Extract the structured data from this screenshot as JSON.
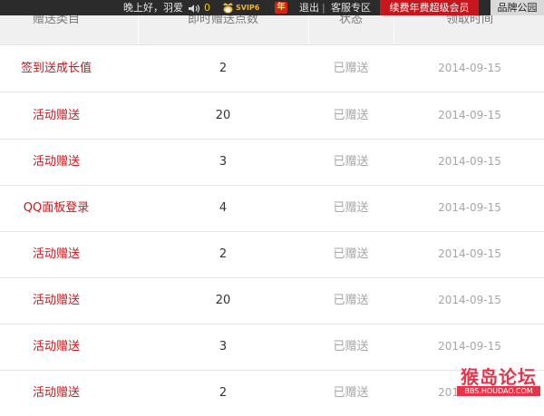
{
  "topbar": {
    "greeting": "晚上好，羽爱",
    "points": "0",
    "vip_label": "SVIP6",
    "nian_badge": "年",
    "logout": "退出",
    "separator": "|",
    "service": "客服专区",
    "renew": "续费年费超级会员",
    "brand": "品牌公园",
    "colors": {
      "bar": "#2b2b2b",
      "renew": "#c8161d",
      "points": "#f2c811"
    }
  },
  "table": {
    "headers": [
      "赠送类目",
      "即时赠送点数",
      "状态",
      "领取时间"
    ],
    "rows": [
      {
        "category": "签到送成长值",
        "points": "2",
        "status": "已赠送",
        "date": "2014-09-15"
      },
      {
        "category": "活动赠送",
        "points": "20",
        "status": "已赠送",
        "date": "2014-09-15"
      },
      {
        "category": "活动赠送",
        "points": "3",
        "status": "已赠送",
        "date": "2014-09-15"
      },
      {
        "category": "QQ面板登录",
        "points": "4",
        "status": "已赠送",
        "date": "2014-09-15"
      },
      {
        "category": "活动赠送",
        "points": "2",
        "status": "已赠送",
        "date": "2014-09-15"
      },
      {
        "category": "活动赠送",
        "points": "20",
        "status": "已赠送",
        "date": "2014-09-15"
      },
      {
        "category": "活动赠送",
        "points": "3",
        "status": "已赠送",
        "date": "2014-09-15"
      },
      {
        "category": "活动赠送",
        "points": "2",
        "status": "已赠送",
        "date": "2014-09-15"
      }
    ],
    "colors": {
      "category": "#c8161d",
      "points": "#333333",
      "status": "#a6a6a6"
    }
  },
  "watermark": {
    "main": "猴岛论坛",
    "sub": "BBS.HOUDAO.COM"
  }
}
